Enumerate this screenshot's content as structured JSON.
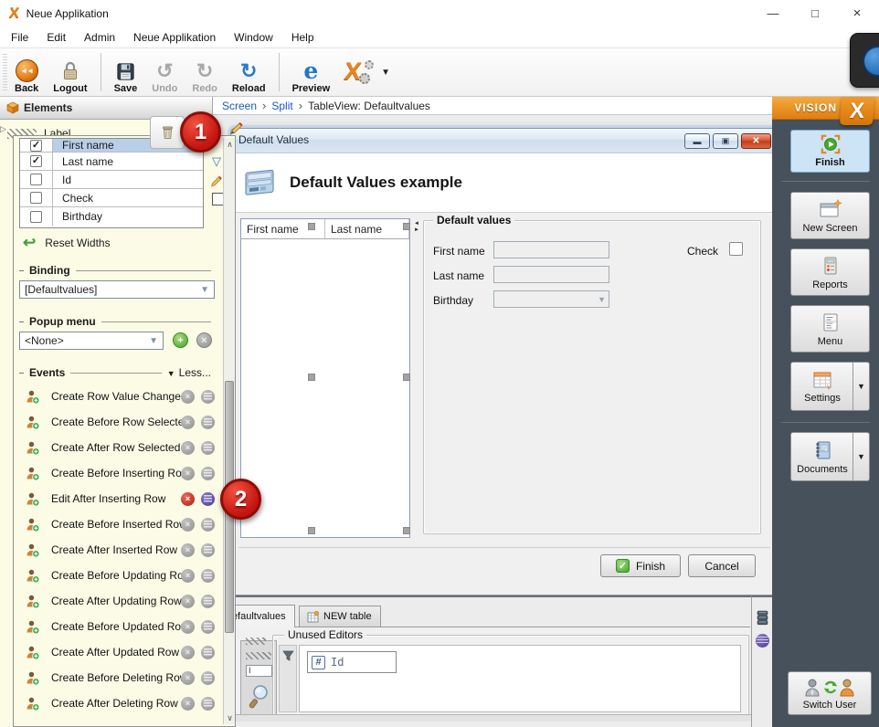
{
  "titlebar": {
    "logo": "X",
    "app_title": "Neue Applikation"
  },
  "menubar": {
    "items": [
      "File",
      "Edit",
      "Admin",
      "Neue Applikation",
      "Window",
      "Help"
    ]
  },
  "toolbar": {
    "back": "Back",
    "logout": "Logout",
    "save": "Save",
    "undo": "Undo",
    "redo": "Redo",
    "reload": "Reload",
    "preview": "Preview"
  },
  "breadcrumb": {
    "items": [
      "Screen",
      "Split"
    ],
    "sep": "›",
    "current": "TableView: Defaultvalues"
  },
  "elements_panel": {
    "title": "Elements",
    "label_row": "Label",
    "columns": [
      {
        "name": "First name",
        "checked": true
      },
      {
        "name": "Last name",
        "checked": true
      },
      {
        "name": "Id",
        "checked": false
      },
      {
        "name": "Check",
        "checked": false
      },
      {
        "name": "Birthday",
        "checked": false
      }
    ],
    "reset_widths": "Reset Widths",
    "binding_title": "Binding",
    "binding_value": "[Defaultvalues]",
    "popup_title": "Popup menu",
    "popup_value": "<None>",
    "events_title": "Events",
    "events_toggle": "Less...",
    "events": [
      "Create Row Value Changed",
      "Create Before Row Selected",
      "Create After Row Selected",
      "Create Before Inserting Row",
      "Edit After Inserting Row",
      "Create Before Inserted Row",
      "Create After Inserted Row",
      "Create Before Updating Row",
      "Create After Updating Row",
      "Create Before Updated Row",
      "Create After Updated Row",
      "Create Before Deleting Row",
      "Create After Deleting Row"
    ]
  },
  "designer": {
    "window_title": "Default Values",
    "screen_title": "Default Values example",
    "table_columns": [
      "First name",
      "Last name"
    ],
    "form": {
      "title": "Default values",
      "first_name_label": "First name",
      "last_name_label": "Last name",
      "birthday_label": "Birthday",
      "check_label": "Check"
    },
    "finish_button": "Finish",
    "cancel_button": "Cancel"
  },
  "bottom_panel": {
    "tabs": [
      {
        "label": "Defaultvalues"
      },
      {
        "label": "NEW table"
      }
    ],
    "unused_editors_title": "Unused Editors",
    "chip_icon": "#",
    "chip_label": "Id"
  },
  "sidebar": {
    "brand": "VISION",
    "brand_x": "X",
    "finish": "Finish",
    "new_screen": "New Screen",
    "reports": "Reports",
    "menu": "Menu",
    "settings": "Settings",
    "documents": "Documents",
    "switch_user": "Switch User"
  },
  "annotations": {
    "badge1": "1",
    "badge2": "2"
  }
}
